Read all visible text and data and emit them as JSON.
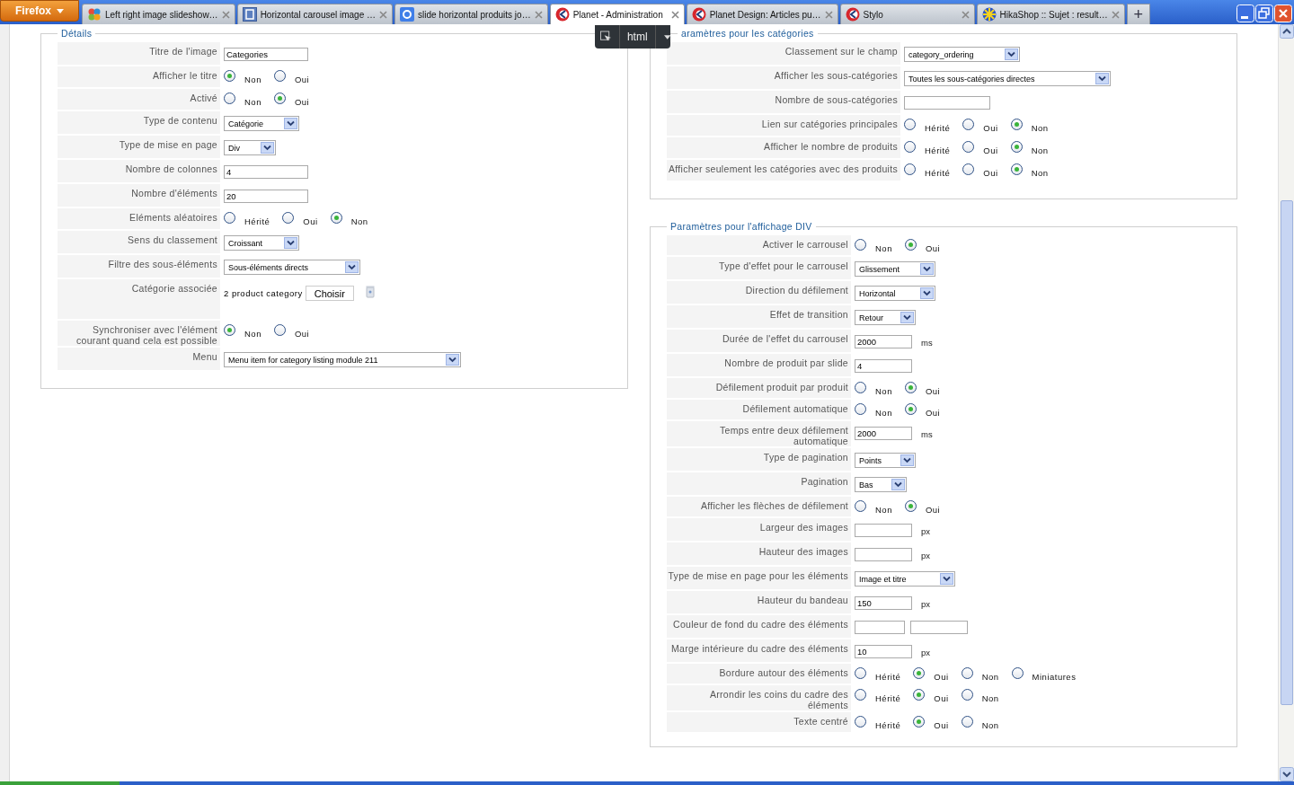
{
  "browser": {
    "menu_button": "Firefox",
    "new_tab": "+",
    "tabs": [
      {
        "title": "Left right image slideshow…",
        "kind": "flower",
        "selected": false
      },
      {
        "title": "Horizontal carousel image …",
        "kind": "square",
        "selected": false
      },
      {
        "title": "slide horizontal produits jo…",
        "kind": "search",
        "selected": false
      },
      {
        "title": "Planet - Administration",
        "kind": "planet",
        "selected": true
      },
      {
        "title": "Planet Design: Articles pu…",
        "kind": "planet",
        "selected": false
      },
      {
        "title": "Stylo",
        "kind": "planet",
        "selected": false
      },
      {
        "title": "HikaShop :: Sujet : result…",
        "kind": "star",
        "selected": false
      }
    ]
  },
  "inspector": {
    "label": "html"
  },
  "sections": [
    {
      "legend": "Détails",
      "rows": [
        {
          "kind": "text",
          "label": "Titre de l'image",
          "value": "Categories"
        },
        {
          "kind": "radio",
          "label": "Afficher le titre",
          "options": [
            {
              "label": "Non",
              "selected": true
            },
            {
              "label": "Oui",
              "selected": false
            }
          ]
        },
        {
          "kind": "radio",
          "label": "Activé",
          "options": [
            {
              "label": "Non",
              "selected": false
            },
            {
              "label": "Oui",
              "selected": true
            }
          ]
        },
        {
          "kind": "select",
          "label": "Type de contenu",
          "value": "Catégorie"
        },
        {
          "kind": "select",
          "label": "Type de mise en page",
          "value": "Div"
        },
        {
          "kind": "text",
          "label": "Nombre de colonnes",
          "value": "4"
        },
        {
          "kind": "text",
          "label": "Nombre d'éléments",
          "value": "20"
        },
        {
          "kind": "radio",
          "label": "Eléments aléatoires",
          "options": [
            {
              "label": "Hérité",
              "selected": false
            },
            {
              "label": "Oui",
              "selected": false
            },
            {
              "label": "Non",
              "selected": true
            }
          ]
        },
        {
          "kind": "select",
          "label": "Sens du classement",
          "value": "Croissant"
        },
        {
          "kind": "select",
          "label": "Filtre des sous-éléments",
          "value": "Sous-éléments directs"
        },
        {
          "kind": "category",
          "label": "Catégorie associée",
          "value": "2 product category",
          "button": "Choisir"
        },
        {
          "kind": "radio",
          "label": "Synchroniser avec l'élément courant quand cela est possible",
          "options": [
            {
              "label": "Non",
              "selected": true
            },
            {
              "label": "Oui",
              "selected": false
            }
          ]
        },
        {
          "kind": "select",
          "label": "Menu",
          "value": "Menu item for category listing module 211"
        }
      ]
    },
    {
      "legend": "aramètres pour les catégories",
      "rows": [
        {
          "kind": "select",
          "label": "Classement sur le champ",
          "value": "category_ordering"
        },
        {
          "kind": "select",
          "label": "Afficher les sous-catégories",
          "value": "Toutes les sous-catégories directes"
        },
        {
          "kind": "text",
          "label": "Nombre de sous-catégories"
        },
        {
          "kind": "radio",
          "label": "Lien sur catégories principales",
          "options": [
            {
              "label": "Hérité",
              "selected": false
            },
            {
              "label": "Oui",
              "selected": false
            },
            {
              "label": "Non",
              "selected": true
            }
          ]
        },
        {
          "kind": "radio",
          "label": "Afficher le nombre de produits",
          "options": [
            {
              "label": "Hérité",
              "selected": false
            },
            {
              "label": "Oui",
              "selected": false
            },
            {
              "label": "Non",
              "selected": true
            }
          ]
        },
        {
          "kind": "radio",
          "label": "Afficher seulement les catégories avec des produits",
          "options": [
            {
              "label": "Hérité",
              "selected": false
            },
            {
              "label": "Oui",
              "selected": false
            },
            {
              "label": "Non",
              "selected": true
            }
          ]
        }
      ]
    },
    {
      "legend": "Paramètres pour l'affichage DIV",
      "rows": [
        {
          "kind": "radio",
          "label": "Activer le carrousel",
          "options": [
            {
              "label": "Non",
              "selected": false
            },
            {
              "label": "Oui",
              "selected": true
            }
          ]
        },
        {
          "kind": "select",
          "label": "Type d'effet pour le carrousel",
          "value": "Glissement"
        },
        {
          "kind": "select",
          "label": "Direction du défilement",
          "value": "Horizontal"
        },
        {
          "kind": "select",
          "label": "Effet de transition",
          "value": "Retour"
        },
        {
          "kind": "text",
          "label": "Durée de l'effet du carrousel",
          "value": "2000",
          "unit": "ms"
        },
        {
          "kind": "text",
          "label": "Nombre de produit par slide",
          "value": "4"
        },
        {
          "kind": "radio",
          "label": "Défilement produit par produit",
          "options": [
            {
              "label": "Non",
              "selected": false
            },
            {
              "label": "Oui",
              "selected": true
            }
          ]
        },
        {
          "kind": "radio",
          "label": "Défilement automatique",
          "options": [
            {
              "label": "Non",
              "selected": false
            },
            {
              "label": "Oui",
              "selected": true
            }
          ]
        },
        {
          "kind": "text",
          "label": "Temps entre deux défilement automatique",
          "value": "2000",
          "unit": "ms"
        },
        {
          "kind": "select",
          "label": "Type de pagination",
          "value": "Points"
        },
        {
          "kind": "select",
          "label": "Pagination",
          "value": "Bas"
        },
        {
          "kind": "radio",
          "label": "Afficher les flèches de défilement",
          "options": [
            {
              "label": "Non",
              "selected": false
            },
            {
              "label": "Oui",
              "selected": true
            }
          ]
        },
        {
          "kind": "text",
          "label": "Largeur des images",
          "unit": "px"
        },
        {
          "kind": "text",
          "label": "Hauteur des images",
          "unit": "px"
        },
        {
          "kind": "select",
          "label": "Type de mise en page pour les éléments",
          "value": "Image et titre"
        },
        {
          "kind": "text",
          "label": "Hauteur du bandeau",
          "value": "150",
          "unit": "px"
        },
        {
          "kind": "pair",
          "label": "Couleur de fond du cadre des éléments"
        },
        {
          "kind": "text",
          "label": "Marge intérieure du cadre des éléments",
          "value": "10",
          "unit": "px"
        },
        {
          "kind": "radio",
          "label": "Bordure autour des éléments",
          "options": [
            {
              "label": "Hérité",
              "selected": false
            },
            {
              "label": "Oui",
              "selected": true
            },
            {
              "label": "Non",
              "selected": false
            },
            {
              "label": "Miniatures",
              "selected": false
            }
          ]
        },
        {
          "kind": "radio",
          "label": "Arrondir les coins du cadre des éléments",
          "options": [
            {
              "label": "Hérité",
              "selected": false
            },
            {
              "label": "Oui",
              "selected": true
            },
            {
              "label": "Non",
              "selected": false
            }
          ]
        },
        {
          "kind": "radio",
          "label": "Texte centré",
          "options": [
            {
              "label": "Hérité",
              "selected": false
            },
            {
              "label": "Oui",
              "selected": true
            },
            {
              "label": "Non",
              "selected": false
            }
          ]
        }
      ]
    }
  ]
}
